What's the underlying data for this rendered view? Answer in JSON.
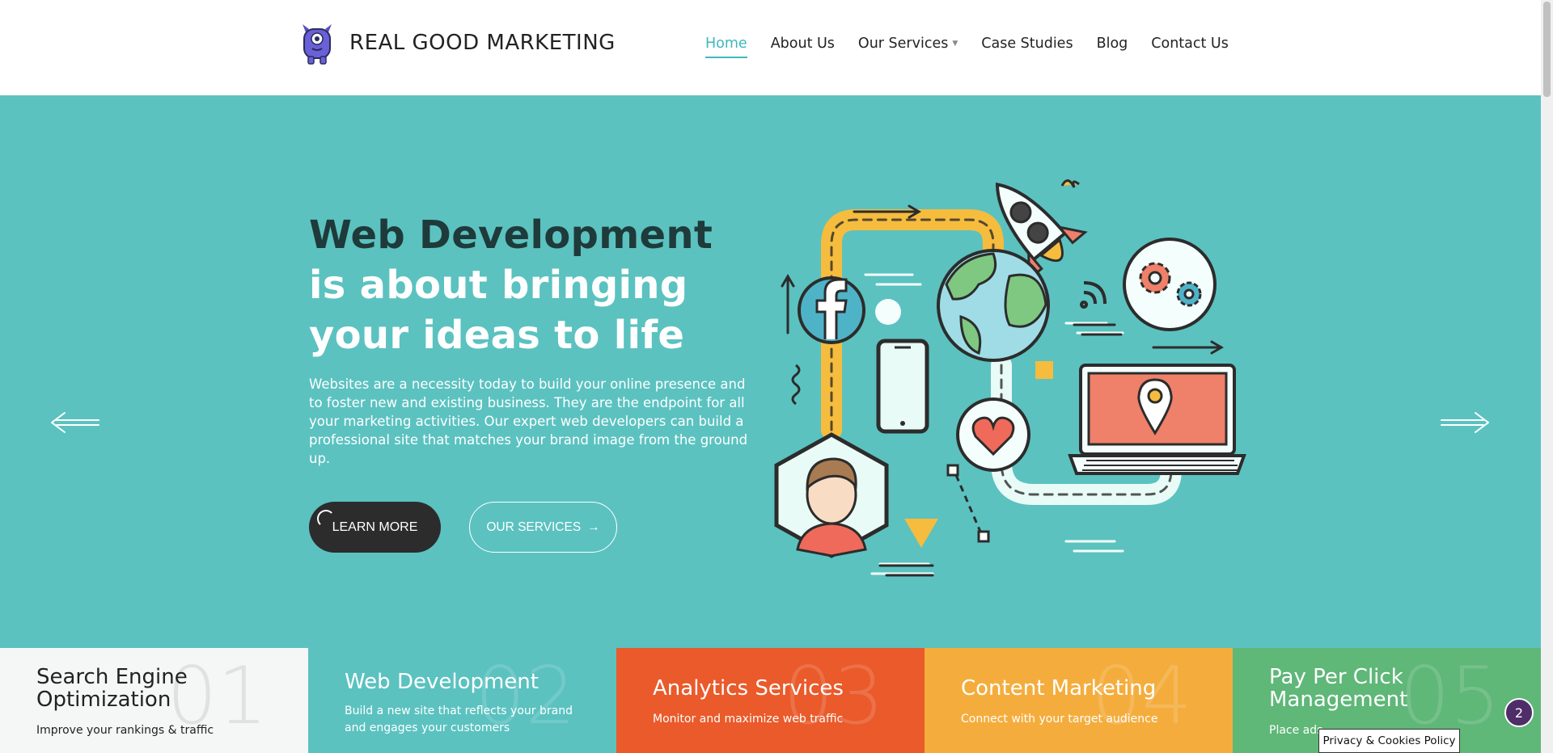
{
  "header": {
    "brand": "REAL GOOD MARKETING",
    "logo_icon": "monster-mascot-icon",
    "nav": [
      {
        "label": "Home",
        "active": true
      },
      {
        "label": "About Us"
      },
      {
        "label": "Our Services",
        "has_dropdown": true
      },
      {
        "label": "Case Studies"
      },
      {
        "label": "Blog"
      },
      {
        "label": "Contact Us"
      }
    ]
  },
  "hero": {
    "title_highlight": "Web Development",
    "title_rest": " is about bringing your ideas to life",
    "text": "Websites are a necessity today to build your online presence and to foster new and existing business. They are the endpoint for all your marketing activities. Our expert web developers can build a professional site that matches your brand image from the ground up.",
    "learn_more": "LEARN MORE",
    "our_services": "OUR SERVICES",
    "background_color": "#5bc2c0"
  },
  "tiles": [
    {
      "num": "01",
      "title": "Search Engine Optimization",
      "sub": "Improve your rankings & traffic",
      "color": "#f5f7f7"
    },
    {
      "num": "02",
      "title": "Web Development",
      "sub": "Build a new site that reflects your brand and engages your customers",
      "color": "#5bc2c0"
    },
    {
      "num": "03",
      "title": "Analytics Services",
      "sub": "Monitor and maximize web traffic",
      "color": "#ea5a2a"
    },
    {
      "num": "04",
      "title": "Content Marketing",
      "sub": "Connect with your target audience",
      "color": "#f4ad3d"
    },
    {
      "num": "05",
      "title": "Pay Per Click Management",
      "sub": "Place ads",
      "color": "#5fb778"
    }
  ],
  "chat_badge": "2",
  "privacy": "Privacy & Cookies Policy"
}
